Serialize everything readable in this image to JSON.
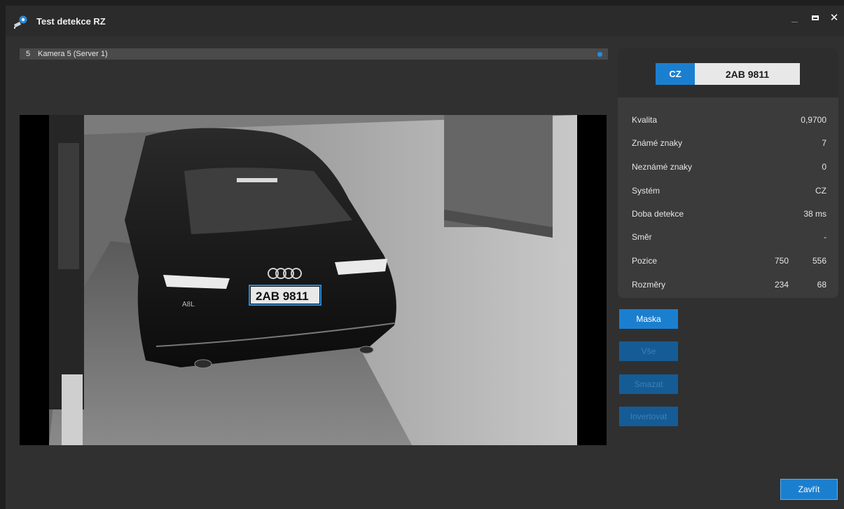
{
  "window": {
    "title": "Test detekce RZ",
    "close_symbol": "✕"
  },
  "camera": {
    "number": "5",
    "name": "Kamera 5 (Server 1)"
  },
  "video": {
    "plate_overlay_text": "2AB 9811",
    "car_text": "A8L"
  },
  "plate": {
    "country": "CZ",
    "text": "2AB 9811"
  },
  "details": {
    "quality": {
      "label": "Kvalita",
      "value": "0,9700"
    },
    "known": {
      "label": "Známé znaky",
      "value": "7"
    },
    "unknown": {
      "label": "Neznámé znaky",
      "value": "0"
    },
    "system": {
      "label": "Systém",
      "value": "CZ"
    },
    "duration": {
      "label": "Doba detekce",
      "value": "38 ms"
    },
    "direction": {
      "label": "Směr",
      "value": "-"
    },
    "position": {
      "label": "Pozice",
      "value_x": "750",
      "value_y": "556"
    },
    "dimensions": {
      "label": "Rozměry",
      "value_w": "234",
      "value_h": "68"
    }
  },
  "buttons": {
    "mask": "Maska",
    "all": "Vše",
    "clear": "Smazat",
    "invert": "Invertovat",
    "close": "Zavřít"
  },
  "colors": {
    "accent": "#1b7fd0",
    "status_dot": "#1f8fe6"
  },
  "icons": {
    "app": "camera-gear-icon",
    "minimize": "minimize-icon",
    "maximize": "maximize-icon",
    "close": "close-icon"
  }
}
